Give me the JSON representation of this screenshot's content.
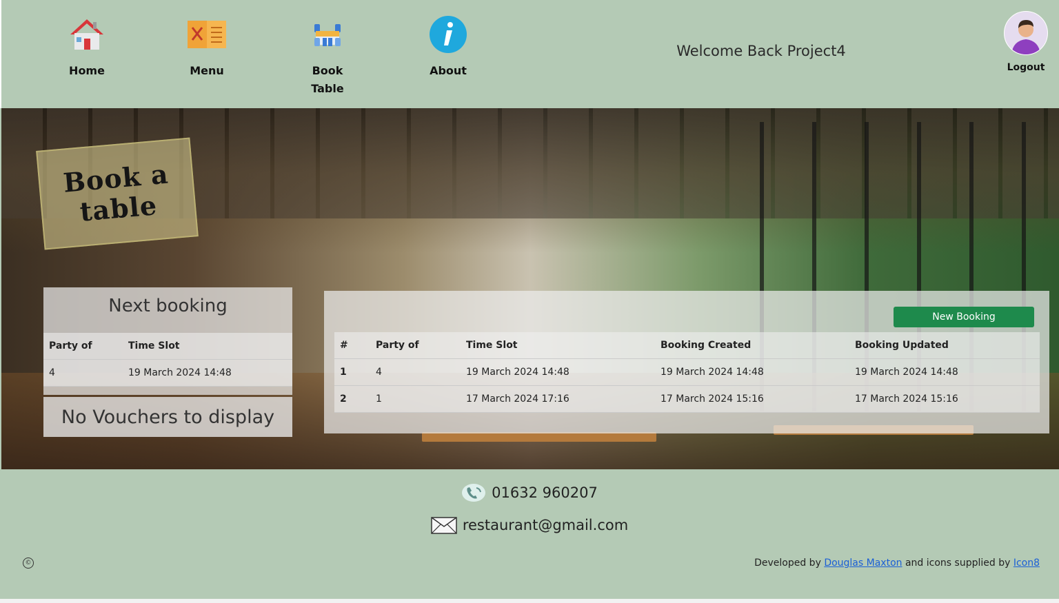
{
  "nav": {
    "items": [
      {
        "label": "Home",
        "icon": "house-icon"
      },
      {
        "label": "Menu",
        "icon": "menu-card-icon"
      },
      {
        "label": "Book Table",
        "icon": "dining-table-icon"
      },
      {
        "label": "About",
        "icon": "info-icon"
      }
    ]
  },
  "header": {
    "welcome": "Welcome Back Project4",
    "logout_label": "Logout"
  },
  "hero": {
    "sign_text": "Book a table"
  },
  "next_booking": {
    "title": "Next booking",
    "columns": [
      "Party of",
      "Time Slot"
    ],
    "row": [
      "4",
      "19 March 2024 14:48"
    ]
  },
  "vouchers": {
    "message": "No Vouchers to display"
  },
  "bookings": {
    "new_button": "New Booking",
    "columns": [
      "#",
      "Party of",
      "Time Slot",
      "Booking Created",
      "Booking Updated"
    ],
    "rows": [
      [
        "1",
        "4",
        "19 March 2024 14:48",
        "19 March 2024 14:48",
        "19 March 2024 14:48"
      ],
      [
        "2",
        "1",
        "17 March 2024 17:16",
        "17 March 2024 15:16",
        "17 March 2024 15:16"
      ]
    ]
  },
  "footer": {
    "phone": "01632 960207",
    "email": "restaurant@gmail.com",
    "copyright_symbol": "©",
    "credits_prefix": "Developed by",
    "author_link": "Douglas Maxton",
    "credits_middle": "and icons supplied by",
    "icons_link": "Icon8"
  },
  "colors": {
    "background": "#b4cab5",
    "accent_button": "#1e8a4c",
    "link": "#1a5fd6"
  }
}
